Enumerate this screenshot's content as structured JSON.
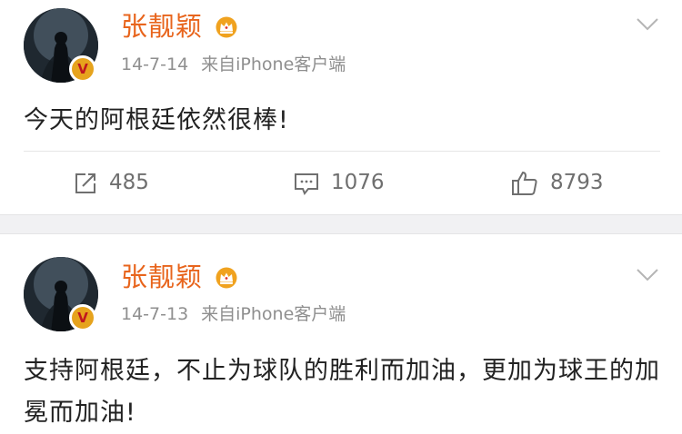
{
  "posts": [
    {
      "username": "张靓颖",
      "date": "14-7-14",
      "source": "来自iPhone客户端",
      "text": "今天的阿根廷依然很棒!",
      "reposts": "485",
      "comments": "1076",
      "likes": "8793",
      "verified_label": "V"
    },
    {
      "username": "张靓颖",
      "date": "14-7-13",
      "source": "来自iPhone客户端",
      "text": "支持阿根廷，不止为球队的胜利而加油，更加为球王的加冕而加油!",
      "verified_label": "V"
    }
  ],
  "colors": {
    "username": "#e8651d",
    "meta": "#8f8f8f",
    "badge": "#e6a31d",
    "badge_mark": "#c0161e",
    "separator": "#f1f1f3"
  },
  "icons": {
    "crown": "crown-icon",
    "menu": "chevron-down-icon",
    "repost": "repost-icon",
    "comment": "comment-icon",
    "like": "thumbs-up-icon"
  }
}
